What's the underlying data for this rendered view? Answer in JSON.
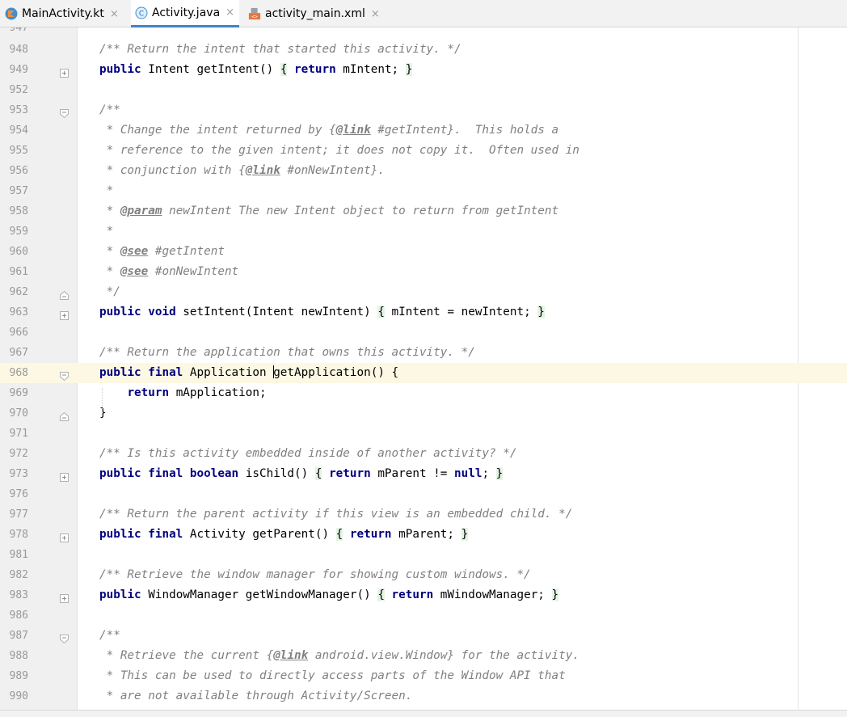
{
  "tabs": [
    {
      "label": "MainActivity.kt",
      "icon": "kotlin-file-icon",
      "active": false,
      "close": "×"
    },
    {
      "label": "Activity.java",
      "icon": "java-class-icon",
      "active": true,
      "close": "×"
    },
    {
      "label": "activity_main.xml",
      "icon": "xml-layout-icon",
      "active": false,
      "close": "×"
    }
  ],
  "top_partial_line": "947",
  "lines": [
    {
      "num": "948",
      "fold": "",
      "parts": [
        [
          "cm",
          "/** Return the intent that started this activity. */"
        ]
      ]
    },
    {
      "num": "949",
      "fold": "plus",
      "parts": [
        [
          "kw",
          "public"
        ],
        [
          "",
          " Intent getIntent() "
        ],
        [
          "br",
          "{"
        ],
        [
          "",
          " "
        ],
        [
          "kw",
          "return"
        ],
        [
          "",
          " mIntent; "
        ],
        [
          "br",
          "}"
        ]
      ]
    },
    {
      "num": "952",
      "fold": "",
      "parts": []
    },
    {
      "num": "953",
      "fold": "open",
      "parts": [
        [
          "cm",
          "/**"
        ]
      ]
    },
    {
      "num": "954",
      "fold": "",
      "parts": [
        [
          "cm",
          " * Change the intent returned by {"
        ],
        [
          "tag",
          "@link"
        ],
        [
          "cm",
          " #getIntent}.  This holds a"
        ]
      ]
    },
    {
      "num": "955",
      "fold": "",
      "parts": [
        [
          "cm",
          " * reference to the given intent; it does not copy it.  Often used in"
        ]
      ]
    },
    {
      "num": "956",
      "fold": "",
      "parts": [
        [
          "cm",
          " * conjunction with {"
        ],
        [
          "tag",
          "@link"
        ],
        [
          "cm",
          " #onNewIntent}."
        ]
      ]
    },
    {
      "num": "957",
      "fold": "",
      "parts": [
        [
          "cm",
          " *"
        ]
      ]
    },
    {
      "num": "958",
      "fold": "",
      "parts": [
        [
          "cm",
          " * "
        ],
        [
          "tag",
          "@param"
        ],
        [
          "cm",
          " newIntent The new Intent object to return from getIntent"
        ]
      ]
    },
    {
      "num": "959",
      "fold": "",
      "parts": [
        [
          "cm",
          " *"
        ]
      ]
    },
    {
      "num": "960",
      "fold": "",
      "parts": [
        [
          "cm",
          " * "
        ],
        [
          "tag",
          "@see"
        ],
        [
          "cm",
          " #getIntent"
        ]
      ]
    },
    {
      "num": "961",
      "fold": "",
      "parts": [
        [
          "cm",
          " * "
        ],
        [
          "tag",
          "@see"
        ],
        [
          "cm",
          " #onNewIntent"
        ]
      ]
    },
    {
      "num": "962",
      "fold": "close",
      "parts": [
        [
          "cm",
          " */"
        ]
      ]
    },
    {
      "num": "963",
      "fold": "plus",
      "parts": [
        [
          "kw",
          "public void"
        ],
        [
          "",
          " setIntent(Intent newIntent) "
        ],
        [
          "br",
          "{"
        ],
        [
          "",
          " mIntent = newIntent; "
        ],
        [
          "br",
          "}"
        ]
      ]
    },
    {
      "num": "966",
      "fold": "",
      "parts": []
    },
    {
      "num": "967",
      "fold": "",
      "parts": [
        [
          "cm",
          "/** Return the application that owns this activity. */"
        ]
      ]
    },
    {
      "num": "968",
      "fold": "open",
      "current": true,
      "parts": [
        [
          "kw",
          "public final"
        ],
        [
          "",
          " Application "
        ],
        [
          "caret",
          ""
        ],
        [
          "",
          "getApplication() {"
        ]
      ]
    },
    {
      "num": "969",
      "fold": "",
      "parts": [
        [
          "",
          "    "
        ],
        [
          "kw",
          "return"
        ],
        [
          "",
          " mApplication;"
        ]
      ]
    },
    {
      "num": "970",
      "fold": "close",
      "parts": [
        [
          "",
          "}"
        ]
      ]
    },
    {
      "num": "971",
      "fold": "",
      "parts": []
    },
    {
      "num": "972",
      "fold": "",
      "parts": [
        [
          "cm",
          "/** Is this activity embedded inside of another activity? */"
        ]
      ]
    },
    {
      "num": "973",
      "fold": "plus",
      "parts": [
        [
          "kw",
          "public final boolean"
        ],
        [
          "",
          " isChild() "
        ],
        [
          "br",
          "{"
        ],
        [
          "",
          " "
        ],
        [
          "kw",
          "return"
        ],
        [
          "",
          " mParent != "
        ],
        [
          "kw",
          "null"
        ],
        [
          "",
          "; "
        ],
        [
          "br",
          "}"
        ]
      ]
    },
    {
      "num": "976",
      "fold": "",
      "parts": []
    },
    {
      "num": "977",
      "fold": "",
      "parts": [
        [
          "cm",
          "/** Return the parent activity if this view is an embedded child. */"
        ]
      ]
    },
    {
      "num": "978",
      "fold": "plus",
      "parts": [
        [
          "kw",
          "public final"
        ],
        [
          "",
          " Activity getParent() "
        ],
        [
          "br",
          "{"
        ],
        [
          "",
          " "
        ],
        [
          "kw",
          "return"
        ],
        [
          "",
          " mParent; "
        ],
        [
          "br",
          "}"
        ]
      ]
    },
    {
      "num": "981",
      "fold": "",
      "parts": []
    },
    {
      "num": "982",
      "fold": "",
      "parts": [
        [
          "cm",
          "/** Retrieve the window manager for showing custom windows. */"
        ]
      ]
    },
    {
      "num": "983",
      "fold": "plus",
      "parts": [
        [
          "kw",
          "public"
        ],
        [
          "",
          " WindowManager getWindowManager() "
        ],
        [
          "br",
          "{"
        ],
        [
          "",
          " "
        ],
        [
          "kw",
          "return"
        ],
        [
          "",
          " mWindowManager; "
        ],
        [
          "br",
          "}"
        ]
      ]
    },
    {
      "num": "986",
      "fold": "",
      "parts": []
    },
    {
      "num": "987",
      "fold": "open",
      "parts": [
        [
          "cm",
          "/**"
        ]
      ]
    },
    {
      "num": "988",
      "fold": "",
      "parts": [
        [
          "cm",
          " * Retrieve the current {"
        ],
        [
          "tag",
          "@link"
        ],
        [
          "cm",
          " android.view.Window} for the activity."
        ]
      ]
    },
    {
      "num": "989",
      "fold": "",
      "parts": [
        [
          "cm",
          " * This can be used to directly access parts of the Window API that"
        ]
      ]
    },
    {
      "num": "990",
      "fold": "",
      "parts": [
        [
          "cm",
          " * are not available through Activity/Screen."
        ]
      ]
    }
  ],
  "colors": {
    "keyword": "#000080",
    "comment": "#808080",
    "current_line": "#fcf8e3",
    "brace_highlight": "#e4f4e4",
    "tab_underline": "#4083c9"
  }
}
